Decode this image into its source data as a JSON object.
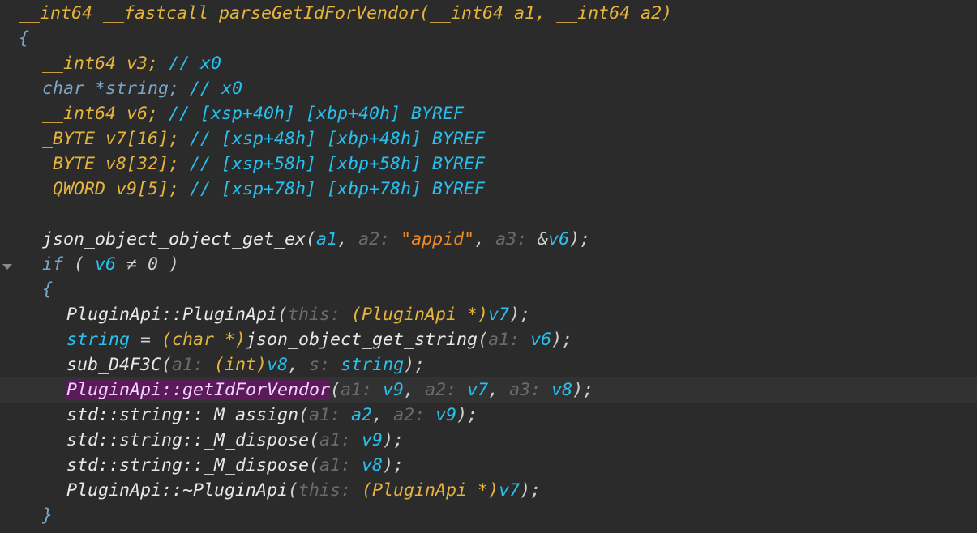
{
  "colors": {
    "background": "#2b2b2b",
    "current_line": "#323232",
    "keyword": "#e6b43c",
    "function": "#e8e8e8",
    "variable": "#27c1f0",
    "comment": "#27c1f0",
    "hint": "#6b6b6b",
    "string": "#f08a26",
    "highlight": "#5b1a59"
  },
  "icons": {
    "fold_marker": "chevron-down-icon"
  },
  "lines": [
    {
      "indent": 0,
      "tokens": [
        {
          "t": "__int64 __fastcall ",
          "c": "kw"
        },
        {
          "t": "parseGetIdForVendor",
          "c": "kw"
        },
        {
          "t": "(",
          "c": "kw"
        },
        {
          "t": "__int64 a1",
          "c": "kw"
        },
        {
          "t": ", ",
          "c": "kw"
        },
        {
          "t": "__int64 a2",
          "c": "kw"
        },
        {
          "t": ")",
          "c": "kw"
        }
      ]
    },
    {
      "indent": 0,
      "tokens": [
        {
          "t": "{",
          "c": "type"
        }
      ]
    },
    {
      "indent": 1,
      "tokens": [
        {
          "t": "__int64 v3",
          "c": "kw"
        },
        {
          "t": "; ",
          "c": "kw"
        },
        {
          "t": "// x0",
          "c": "cmt"
        }
      ]
    },
    {
      "indent": 1,
      "tokens": [
        {
          "t": "char *string",
          "c": "type"
        },
        {
          "t": "; ",
          "c": "type"
        },
        {
          "t": "// x0",
          "c": "cmt"
        }
      ]
    },
    {
      "indent": 1,
      "tokens": [
        {
          "t": "__int64 v6",
          "c": "kw"
        },
        {
          "t": "; ",
          "c": "kw"
        },
        {
          "t": "// [xsp+40h] [xbp+40h] BYREF",
          "c": "cmt"
        }
      ]
    },
    {
      "indent": 1,
      "tokens": [
        {
          "t": "_BYTE v7[16]",
          "c": "kw"
        },
        {
          "t": "; ",
          "c": "kw"
        },
        {
          "t": "// [xsp+48h] [xbp+48h] BYREF",
          "c": "cmt"
        }
      ]
    },
    {
      "indent": 1,
      "tokens": [
        {
          "t": "_BYTE v8[32]",
          "c": "kw"
        },
        {
          "t": "; ",
          "c": "kw"
        },
        {
          "t": "// [xsp+58h] [xbp+58h] BYREF",
          "c": "cmt"
        }
      ]
    },
    {
      "indent": 1,
      "tokens": [
        {
          "t": "_QWORD v9[5]",
          "c": "kw"
        },
        {
          "t": "; ",
          "c": "kw"
        },
        {
          "t": "// [xsp+78h] [xbp+78h] BYREF",
          "c": "cmt"
        }
      ]
    },
    {
      "indent": 0,
      "tokens": []
    },
    {
      "indent": 1,
      "tokens": [
        {
          "t": "json_object_object_get_ex",
          "c": "fn"
        },
        {
          "t": "(",
          "c": "punc"
        },
        {
          "t": "a1",
          "c": "var"
        },
        {
          "t": ", ",
          "c": "punc"
        },
        {
          "t": "a2: ",
          "c": "hint"
        },
        {
          "t": "\"appid\"",
          "c": "str"
        },
        {
          "t": ", ",
          "c": "punc"
        },
        {
          "t": "a3: ",
          "c": "hint"
        },
        {
          "t": "&",
          "c": "op"
        },
        {
          "t": "v6",
          "c": "var"
        },
        {
          "t": ");",
          "c": "punc"
        }
      ]
    },
    {
      "indent": 1,
      "tokens": [
        {
          "t": "if",
          "c": "type"
        },
        {
          "t": " ( ",
          "c": "punc"
        },
        {
          "t": "v6",
          "c": "var"
        },
        {
          "t": " ≠ 0 )",
          "c": "punc"
        }
      ]
    },
    {
      "indent": 1,
      "tokens": [
        {
          "t": "{",
          "c": "type"
        }
      ]
    },
    {
      "indent": 2,
      "tokens": [
        {
          "t": "PluginApi::PluginApi",
          "c": "fn"
        },
        {
          "t": "(",
          "c": "punc"
        },
        {
          "t": "this: ",
          "c": "hint"
        },
        {
          "t": "(PluginApi *)",
          "c": "kw"
        },
        {
          "t": "v7",
          "c": "var"
        },
        {
          "t": ");",
          "c": "punc"
        }
      ]
    },
    {
      "indent": 2,
      "tokens": [
        {
          "t": "string",
          "c": "var"
        },
        {
          "t": " = ",
          "c": "op"
        },
        {
          "t": "(char *)",
          "c": "kw"
        },
        {
          "t": "json_object_get_string",
          "c": "fn"
        },
        {
          "t": "(",
          "c": "punc"
        },
        {
          "t": "a1: ",
          "c": "hint"
        },
        {
          "t": "v6",
          "c": "var"
        },
        {
          "t": ");",
          "c": "punc"
        }
      ]
    },
    {
      "indent": 2,
      "tokens": [
        {
          "t": "sub_D4F3C",
          "c": "fn"
        },
        {
          "t": "(",
          "c": "punc"
        },
        {
          "t": "a1: ",
          "c": "hint"
        },
        {
          "t": "(int)",
          "c": "kw"
        },
        {
          "t": "v8",
          "c": "var"
        },
        {
          "t": ", ",
          "c": "punc"
        },
        {
          "t": "s: ",
          "c": "hint"
        },
        {
          "t": "string",
          "c": "var"
        },
        {
          "t": ");",
          "c": "punc"
        }
      ]
    },
    {
      "indent": 2,
      "current": true,
      "tokens": [
        {
          "t": "PluginApi::getIdForVendor",
          "c": "hl"
        },
        {
          "t": "(",
          "c": "punc"
        },
        {
          "t": "a1: ",
          "c": "hint"
        },
        {
          "t": "v9",
          "c": "var"
        },
        {
          "t": ", ",
          "c": "punc"
        },
        {
          "t": "a2: ",
          "c": "hint"
        },
        {
          "t": "v7",
          "c": "var"
        },
        {
          "t": ", ",
          "c": "punc"
        },
        {
          "t": "a3: ",
          "c": "hint"
        },
        {
          "t": "v8",
          "c": "var"
        },
        {
          "t": ");",
          "c": "punc"
        }
      ]
    },
    {
      "indent": 2,
      "tokens": [
        {
          "t": "std::string::_M_assign",
          "c": "fn"
        },
        {
          "t": "(",
          "c": "punc"
        },
        {
          "t": "a1: ",
          "c": "hint"
        },
        {
          "t": "a2",
          "c": "var"
        },
        {
          "t": ", ",
          "c": "punc"
        },
        {
          "t": "a2: ",
          "c": "hint"
        },
        {
          "t": "v9",
          "c": "var"
        },
        {
          "t": ");",
          "c": "punc"
        }
      ]
    },
    {
      "indent": 2,
      "tokens": [
        {
          "t": "std::string::_M_dispose",
          "c": "fn"
        },
        {
          "t": "(",
          "c": "punc"
        },
        {
          "t": "a1: ",
          "c": "hint"
        },
        {
          "t": "v9",
          "c": "var"
        },
        {
          "t": ");",
          "c": "punc"
        }
      ]
    },
    {
      "indent": 2,
      "tokens": [
        {
          "t": "std::string::_M_dispose",
          "c": "fn"
        },
        {
          "t": "(",
          "c": "punc"
        },
        {
          "t": "a1: ",
          "c": "hint"
        },
        {
          "t": "v8",
          "c": "var"
        },
        {
          "t": ");",
          "c": "punc"
        }
      ]
    },
    {
      "indent": 2,
      "tokens": [
        {
          "t": "PluginApi::~PluginApi",
          "c": "fn"
        },
        {
          "t": "(",
          "c": "punc"
        },
        {
          "t": "this: ",
          "c": "hint"
        },
        {
          "t": "(PluginApi *)",
          "c": "kw"
        },
        {
          "t": "v7",
          "c": "var"
        },
        {
          "t": ");",
          "c": "punc"
        }
      ]
    },
    {
      "indent": 1,
      "tokens": [
        {
          "t": "}",
          "c": "type"
        }
      ]
    }
  ]
}
